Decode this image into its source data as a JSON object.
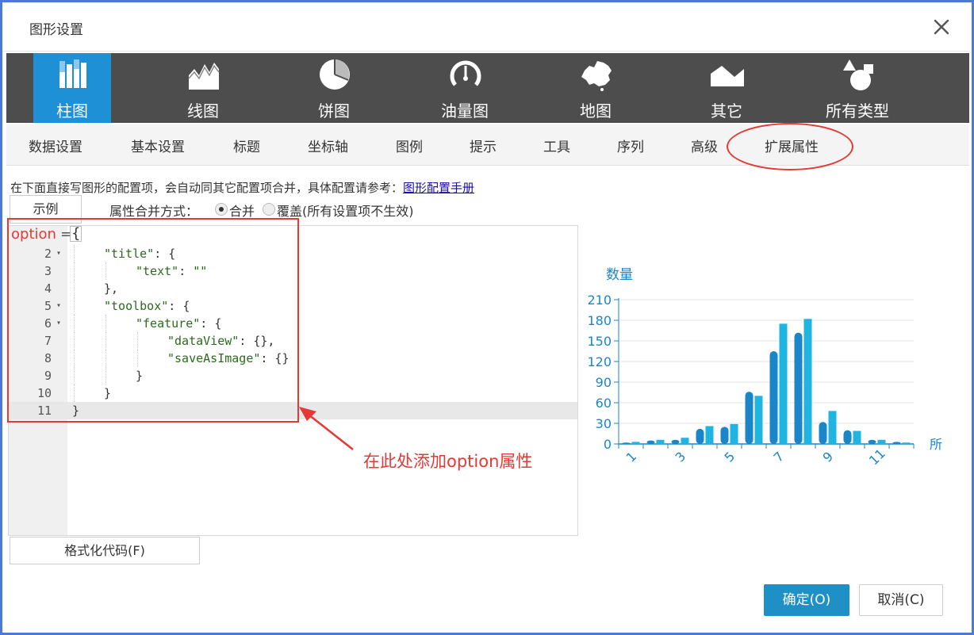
{
  "dialog": {
    "title": "图形设置"
  },
  "chart_types": [
    {
      "label": "柱图",
      "icon": "bar-chart-icon",
      "active": true
    },
    {
      "label": "线图",
      "icon": "line-chart-icon"
    },
    {
      "label": "饼图",
      "icon": "pie-chart-icon"
    },
    {
      "label": "油量图",
      "icon": "gauge-icon"
    },
    {
      "label": "地图",
      "icon": "china-map-icon"
    },
    {
      "label": "其它",
      "icon": "area-shape-icon"
    },
    {
      "label": "所有类型",
      "icon": "shapes-icon"
    }
  ],
  "tabs": [
    "数据设置",
    "基本设置",
    "标题",
    "坐标轴",
    "图例",
    "提示",
    "工具",
    "序列",
    "高级",
    "扩展属性"
  ],
  "active_tab": "扩展属性",
  "info": {
    "text": "在下面直接写图形的配置项，会自动同其它配置项合并，具体配置请参考：",
    "link": "图形配置手册"
  },
  "example_button": "示例",
  "merge": {
    "label": "属性合并方式：",
    "options": [
      "合并",
      "覆盖(所有设置项不生效)"
    ],
    "selected": "合并"
  },
  "editor": {
    "prefix_name": "option",
    "prefix_eq": "=",
    "first_brace": "{",
    "lines": [
      {
        "n": "2",
        "fold": true,
        "indent": 1,
        "parts": [
          [
            "k",
            "\"title\""
          ],
          [
            "p",
            ": {"
          ]
        ]
      },
      {
        "n": "3",
        "fold": false,
        "indent": 2,
        "parts": [
          [
            "k",
            "\"text\""
          ],
          [
            "p",
            ": "
          ],
          [
            "k",
            "\"\""
          ]
        ]
      },
      {
        "n": "4",
        "fold": false,
        "indent": 1,
        "parts": [
          [
            "p",
            "},"
          ]
        ]
      },
      {
        "n": "5",
        "fold": true,
        "indent": 1,
        "parts": [
          [
            "k",
            "\"toolbox\""
          ],
          [
            "p",
            ": {"
          ]
        ]
      },
      {
        "n": "6",
        "fold": true,
        "indent": 2,
        "parts": [
          [
            "k",
            "\"feature\""
          ],
          [
            "p",
            ": {"
          ]
        ]
      },
      {
        "n": "7",
        "fold": false,
        "indent": 3,
        "parts": [
          [
            "k",
            "\"dataView\""
          ],
          [
            "p",
            ": {},"
          ]
        ]
      },
      {
        "n": "8",
        "fold": false,
        "indent": 3,
        "parts": [
          [
            "k",
            "\"saveAsImage\""
          ],
          [
            "p",
            ": {}"
          ]
        ]
      },
      {
        "n": "9",
        "fold": false,
        "indent": 2,
        "parts": [
          [
            "p",
            "}"
          ]
        ]
      },
      {
        "n": "10",
        "fold": false,
        "indent": 1,
        "parts": [
          [
            "p",
            "}"
          ]
        ]
      },
      {
        "n": "11",
        "fold": false,
        "indent": 0,
        "parts": [
          [
            "p",
            "}"
          ]
        ]
      }
    ]
  },
  "annotation": "在此处添加option属性",
  "format_button": "格式化代码(F)",
  "ok_button": "确定(O)",
  "cancel_button": "取消(C)",
  "colors": {
    "accent": "#1e90d6",
    "highlight": "#e53935",
    "dark_bar": "#1a86c8",
    "light_bar": "#1fb5e0"
  },
  "chart_data": {
    "type": "bar",
    "ylabel": "数量",
    "xlabel_partial": "所",
    "ylim": [
      0,
      210
    ],
    "yticks": [
      "0",
      "30",
      "60",
      "90",
      "120",
      "150",
      "180",
      "210"
    ],
    "x_tick_labels": [
      "1",
      "3",
      "5",
      "7",
      "9",
      "11"
    ],
    "categories": [
      "1",
      "2",
      "3",
      "4",
      "5",
      "6",
      "7",
      "8",
      "9",
      "10",
      "11",
      "12"
    ],
    "series": [
      {
        "values": [
          2,
          5,
          6,
          22,
          25,
          76,
          135,
          162,
          32,
          20,
          6,
          3
        ]
      },
      {
        "values": [
          3,
          6,
          9,
          26,
          29,
          70,
          175,
          182,
          48,
          19,
          6,
          2
        ]
      }
    ],
    "grid": true
  }
}
